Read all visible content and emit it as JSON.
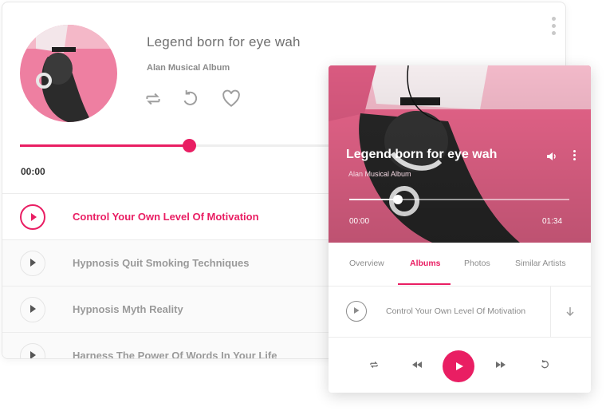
{
  "back_player": {
    "title": "Legend born for eye wah",
    "album": "Alan Musical Album",
    "progress": 0.53,
    "time_current": "00:00",
    "controls": [
      "repeat-icon",
      "replay-icon",
      "heart-icon"
    ]
  },
  "tracks": [
    {
      "label": "Control Your Own Level Of Motivation",
      "active": true
    },
    {
      "label": "Hypnosis Quit Smoking Techniques",
      "active": false
    },
    {
      "label": "Hypnosis Myth Reality",
      "active": false
    },
    {
      "label": "Harness The Power Of Words In Your Life",
      "active": false
    }
  ],
  "front_player": {
    "title": "Legend born for eye wah",
    "album": "Alan Musical Album",
    "progress": 0.22,
    "time_start": "00:00",
    "time_end": "01:34",
    "tabs": [
      {
        "label": "Overview",
        "active": false
      },
      {
        "label": "Albums",
        "active": true
      },
      {
        "label": "Photos",
        "active": false
      },
      {
        "label": "Similar Artists",
        "active": false
      }
    ],
    "queue_item": "Control Your Own Level Of Motivation",
    "controls": [
      "repeat-icon",
      "rewind-icon",
      "play-icon",
      "fast-forward-icon",
      "replay-icon"
    ]
  },
  "colors": {
    "accent": "#e91e63",
    "hero_pink": "#e7648a",
    "text_gray": "#9a9a9a"
  }
}
